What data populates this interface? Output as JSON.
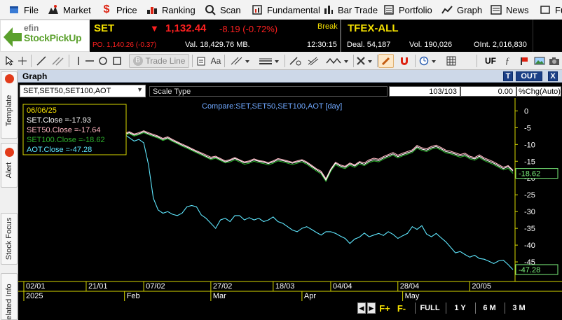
{
  "menu": [
    {
      "label": "File",
      "icon": "file-icon"
    },
    {
      "label": "Market",
      "icon": "market-icon"
    },
    {
      "label": "Price",
      "icon": "price-icon"
    },
    {
      "label": "Ranking",
      "icon": "ranking-icon"
    },
    {
      "label": "Scan",
      "icon": "scan-icon"
    },
    {
      "label": "Fundamental",
      "icon": "fundamental-icon"
    },
    {
      "label": "Bar Trade",
      "icon": "bar-trade-icon"
    },
    {
      "label": "Portfolio",
      "icon": "portfolio-icon"
    },
    {
      "label": "Graph",
      "icon": "graph-icon"
    },
    {
      "label": "News",
      "icon": "news-icon"
    },
    {
      "label": "Fu",
      "icon": "futures-icon"
    }
  ],
  "logo": {
    "line1": "efin",
    "line2": "StockPickUp"
  },
  "quote_set": {
    "symbol": "SET",
    "arrow": "▼",
    "last": "1,132.44",
    "change": "-8.19 (-0.72%)",
    "status": "Break",
    "projected": "PO. 1,140.26 (-0.37)",
    "value": "Val. 18,429.76 MB.",
    "time": "12:30:15"
  },
  "quote_tfex": {
    "symbol": "TFEX-ALL",
    "deal": "Deal. 54,187",
    "volume": "Vol. 190,026",
    "open_interest": "OInt. 2,016,830"
  },
  "toolbar": {
    "trade_line_label": "Trade Line",
    "text_label": "Aa",
    "uf_label": "UF"
  },
  "sidetabs": [
    "Template",
    "Alert",
    "Stock Focus",
    "Related Info"
  ],
  "graph": {
    "title": "Graph",
    "btn_t": "T",
    "btn_out": "OUT",
    "btn_close": "X",
    "symbols_select": "SET,SET50,SET100,AOT",
    "scale_type_label": "Scale Type",
    "scale_count": "103/103",
    "scale_value": "0.00",
    "scale_mode": "%Chg(Auto)",
    "nav": {
      "f_plus": "F+",
      "f_minus": "F-",
      "full": "FULL",
      "one_y": "1 Y",
      "six_m": "6 M",
      "three_m": "3 M"
    }
  },
  "chart_data": {
    "type": "line",
    "title": "Compare:SET,SET50,SET100,AOT [day]",
    "tooltip": {
      "date": "06/06/25",
      "rows": [
        {
          "label": "SET.Close =-17.93",
          "color": "#ffffff"
        },
        {
          "label": "SET50.Close =-17.64",
          "color": "#ffb6c1"
        },
        {
          "label": "SET100.Close =-18.62",
          "color": "#2db12d"
        },
        {
          "label": "AOT.Close =-47.28",
          "color": "#5fe8ff"
        }
      ]
    },
    "ylim": [
      -50,
      3
    ],
    "y_ticks": [
      0,
      -5,
      -10,
      -15,
      -20,
      -25,
      -30,
      -35,
      -40,
      -45
    ],
    "x_tick_labels": [
      "02/01",
      "21/01",
      "07/02",
      "27/02",
      "18/03",
      "04/04",
      "28/04",
      "20/05"
    ],
    "x_tick_index": [
      0,
      13,
      25,
      39,
      52,
      64,
      78,
      93
    ],
    "month_labels": [
      {
        "label": "2025",
        "index": 0
      },
      {
        "label": "Feb",
        "index": 21
      },
      {
        "label": "Mar",
        "index": 39
      },
      {
        "label": "Apr",
        "index": 58
      },
      {
        "label": "May",
        "index": 79
      }
    ],
    "last_value_labels": [
      {
        "text": "-18.62",
        "color": "#7cf07c"
      },
      {
        "text": "-47.28",
        "color": "#7cf07c"
      }
    ],
    "grid": false,
    "series": [
      {
        "name": "SET",
        "color": "#ffffff",
        "values": [
          -0.5,
          -1.2,
          -1.8,
          -1.5,
          -2.2,
          -3.5,
          -3.0,
          -2.5,
          -3.8,
          -3.2,
          -4.0,
          -4.8,
          -4.2,
          -5.2,
          -5.8,
          -5.5,
          -6.2,
          -5.8,
          -6.6,
          -7.2,
          -7.8,
          -7.0,
          -6.5,
          -7.2,
          -6.8,
          -6.2,
          -6.8,
          -7.3,
          -7.8,
          -8.5,
          -8.0,
          -8.8,
          -9.5,
          -10.2,
          -10.8,
          -11.5,
          -12.2,
          -12.8,
          -13.5,
          -14.2,
          -13.8,
          -14.5,
          -15.2,
          -14.8,
          -14.2,
          -14.8,
          -15.5,
          -15.2,
          -14.6,
          -15.0,
          -15.3,
          -15.7,
          -15.2,
          -14.5,
          -14.8,
          -15.2,
          -15.6,
          -15.2,
          -14.8,
          -15.5,
          -16.5,
          -17.5,
          -18.4,
          -20.6,
          -17.6,
          -15.6,
          -16.4,
          -16.8,
          -15.8,
          -16.4,
          -15.4,
          -15.9,
          -15.0,
          -14.5,
          -14.8,
          -14.0,
          -13.4,
          -12.8,
          -13.6,
          -13.0,
          -12.5,
          -12.0,
          -10.7,
          -11.4,
          -11.7,
          -11.0,
          -10.6,
          -11.3,
          -12.1,
          -12.4,
          -12.9,
          -13.4,
          -13.0,
          -13.9,
          -14.3,
          -13.5,
          -14.4,
          -15.0,
          -15.6,
          -16.4,
          -17.2,
          -16.6,
          -17.93
        ]
      },
      {
        "name": "SET50",
        "color": "#ffb6c1",
        "values": [
          -0.3,
          -1.0,
          -1.5,
          -1.2,
          -2.0,
          -3.2,
          -2.7,
          -2.1,
          -3.4,
          -2.8,
          -3.6,
          -4.4,
          -3.8,
          -4.8,
          -5.3,
          -5.1,
          -5.8,
          -5.5,
          -6.3,
          -6.9,
          -7.4,
          -6.7,
          -6.2,
          -6.9,
          -6.5,
          -5.9,
          -6.5,
          -7.0,
          -7.5,
          -8.2,
          -7.7,
          -8.5,
          -9.2,
          -9.9,
          -10.5,
          -11.2,
          -11.9,
          -12.5,
          -13.1,
          -13.8,
          -13.5,
          -14.2,
          -14.9,
          -14.5,
          -13.9,
          -14.6,
          -15.2,
          -14.9,
          -14.3,
          -14.8,
          -15.0,
          -15.4,
          -14.9,
          -14.2,
          -14.5,
          -14.9,
          -15.3,
          -14.9,
          -14.5,
          -15.2,
          -16.2,
          -17.2,
          -18.0,
          -20.2,
          -17.3,
          -15.3,
          -16.1,
          -16.5,
          -15.5,
          -16.1,
          -15.1,
          -15.5,
          -14.6,
          -14.1,
          -14.4,
          -13.6,
          -13.0,
          -12.4,
          -13.2,
          -12.6,
          -12.1,
          -11.6,
          -10.3,
          -11.0,
          -11.3,
          -10.6,
          -10.2,
          -10.9,
          -11.7,
          -12.0,
          -12.5,
          -13.0,
          -12.6,
          -13.5,
          -13.9,
          -13.1,
          -14.0,
          -14.6,
          -15.2,
          -16.0,
          -16.8,
          -16.3,
          -17.64
        ]
      },
      {
        "name": "SET100",
        "color": "#2db12d",
        "values": [
          -0.6,
          -1.4,
          -2.0,
          -1.7,
          -2.4,
          -3.7,
          -3.3,
          -2.8,
          -4.1,
          -3.5,
          -4.3,
          -5.1,
          -4.5,
          -5.5,
          -6.1,
          -5.8,
          -6.5,
          -6.1,
          -6.9,
          -7.5,
          -8.1,
          -7.3,
          -6.8,
          -7.5,
          -7.1,
          -6.5,
          -7.1,
          -7.6,
          -8.1,
          -8.8,
          -8.3,
          -9.1,
          -9.8,
          -10.5,
          -11.1,
          -11.8,
          -12.5,
          -13.1,
          -13.8,
          -14.5,
          -14.1,
          -14.8,
          -15.5,
          -15.2,
          -14.6,
          -15.2,
          -15.9,
          -15.6,
          -15.0,
          -15.4,
          -15.7,
          -16.1,
          -15.6,
          -14.9,
          -15.2,
          -15.6,
          -16.0,
          -15.6,
          -15.2,
          -15.9,
          -16.9,
          -17.9,
          -18.8,
          -21.0,
          -18.0,
          -16.0,
          -16.8,
          -17.2,
          -16.2,
          -16.8,
          -15.8,
          -16.3,
          -15.4,
          -14.9,
          -15.2,
          -14.4,
          -13.8,
          -13.2,
          -14.0,
          -13.4,
          -12.9,
          -12.4,
          -11.1,
          -11.8,
          -12.1,
          -11.4,
          -11.0,
          -11.7,
          -12.5,
          -12.8,
          -13.3,
          -13.8,
          -13.4,
          -14.3,
          -14.7,
          -13.9,
          -14.8,
          -15.4,
          -16.0,
          -16.8,
          -17.6,
          -17.1,
          -18.62
        ]
      },
      {
        "name": "AOT",
        "color": "#5fe8ff",
        "values": [
          0.5,
          -0.5,
          -2.0,
          -3.5,
          -1.5,
          -3.0,
          -4.5,
          -3.5,
          -5.5,
          -6.5,
          -5.0,
          -7.0,
          -6.0,
          -4.0,
          -5.5,
          -7.5,
          -8.5,
          -7.0,
          -6.0,
          -6.8,
          -7.5,
          -7.0,
          -8.0,
          -9.0,
          -8.5,
          -9.5,
          -16.0,
          -26.0,
          -29.5,
          -30.5,
          -30.0,
          -30.8,
          -31.2,
          -30.5,
          -28.6,
          -28.2,
          -28.6,
          -31.0,
          -32.0,
          -33.5,
          -35.0,
          -32.5,
          -32.0,
          -33.0,
          -31.2,
          -31.2,
          -32.5,
          -31.8,
          -32.5,
          -32.0,
          -33.0,
          -32.5,
          -31.6,
          -33.0,
          -33.5,
          -34.5,
          -35.5,
          -36.0,
          -35.0,
          -34.5,
          -35.3,
          -36.2,
          -37.0,
          -36.0,
          -36.0,
          -36.5,
          -37.3,
          -38.0,
          -39.5,
          -38.2,
          -37.6,
          -36.4,
          -37.5,
          -37.0,
          -36.5,
          -37.1,
          -36.0,
          -36.8,
          -38.0,
          -37.2,
          -36.5,
          -34.5,
          -35.3,
          -34.2,
          -36.7,
          -37.5,
          -36.5,
          -37.8,
          -39.0,
          -40.6,
          -42.3,
          -41.9,
          -42.8,
          -43.6,
          -43.0,
          -44.0,
          -44.2,
          -44.8,
          -45.5,
          -44.7,
          -44.5,
          -45.8,
          -47.28
        ]
      }
    ]
  }
}
